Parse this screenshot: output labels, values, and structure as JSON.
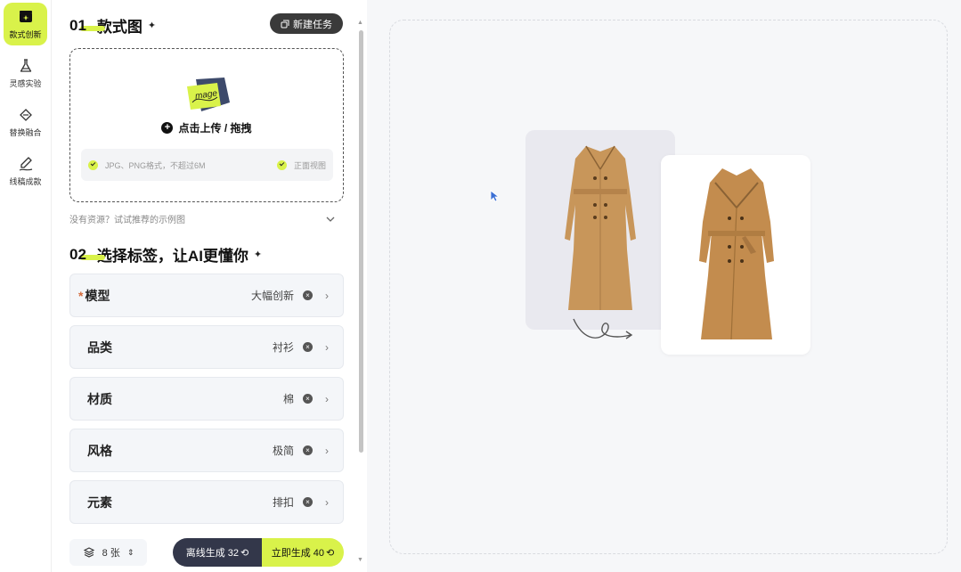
{
  "rail": {
    "items": [
      {
        "label": "款式创新",
        "icon": "sparkle-box-icon",
        "active": true
      },
      {
        "label": "灵感实验",
        "icon": "flask-icon",
        "active": false
      },
      {
        "label": "替换融合",
        "icon": "diamond-icon",
        "active": false
      },
      {
        "label": "线稿成款",
        "icon": "pen-line-icon",
        "active": false
      }
    ]
  },
  "section1": {
    "num": "01",
    "title": "款式图",
    "new_task": "新建任务"
  },
  "upload": {
    "badge_text": "mage",
    "label": "点击上传 / 拖拽",
    "hint_left": "JPG、PNG格式，不超过6M",
    "hint_right": "正面视图"
  },
  "no_resource": "没有资源？试试推荐的示例图",
  "section2": {
    "num": "02",
    "title": "选择标签，让AI更懂你"
  },
  "tags": [
    {
      "name": "模型",
      "value": "大幅创新",
      "required": true
    },
    {
      "name": "品类",
      "value": "衬衫",
      "required": false
    },
    {
      "name": "材质",
      "value": "棉",
      "required": false
    },
    {
      "name": "风格",
      "value": "极简",
      "required": false
    },
    {
      "name": "元素",
      "value": "排扣",
      "required": false
    }
  ],
  "bottom": {
    "count": "8 张",
    "offline": "离线生成 32",
    "now": "立即生成 40"
  },
  "colors": {
    "accent": "#d9f24a",
    "dark": "#33374a",
    "coat": "#c8965a"
  }
}
